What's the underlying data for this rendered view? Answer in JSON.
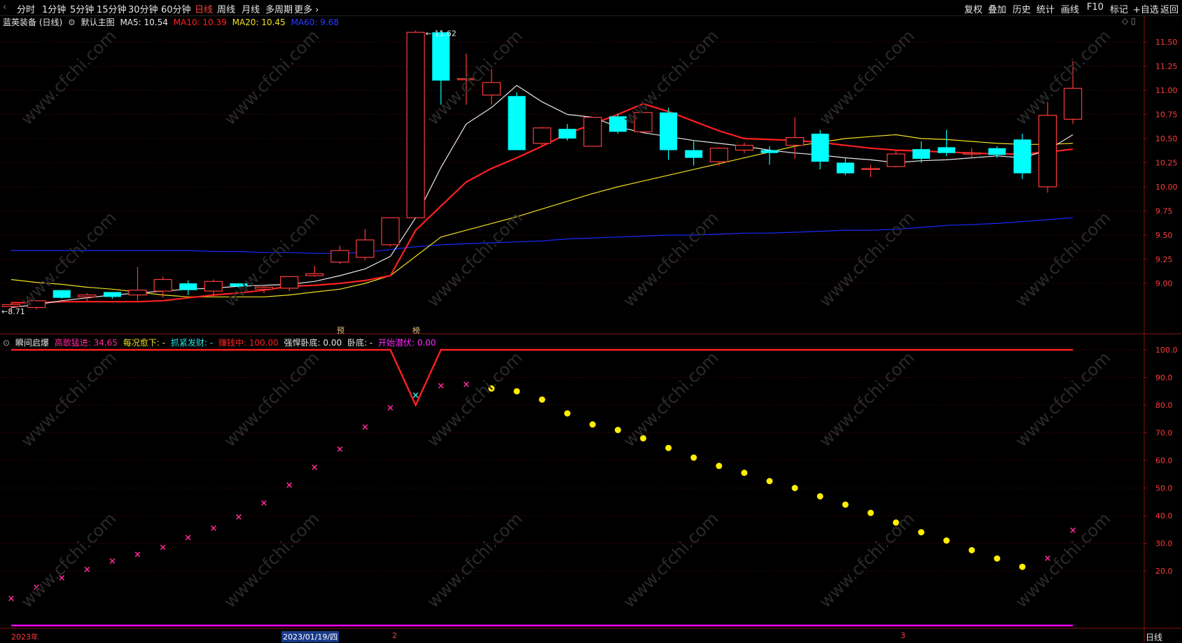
{
  "toolbar": {
    "periods": [
      "分时",
      "1分钟",
      "5分钟",
      "15分钟",
      "30分钟",
      "60分钟",
      "日线",
      "周线",
      "月线",
      "多周期",
      "更多 ›"
    ],
    "active_period": "日线",
    "right": [
      "复权",
      "叠加",
      "历史",
      "统计",
      "画线",
      "F10",
      "标记",
      "+自选",
      "返回"
    ]
  },
  "main": {
    "stock": "蓝英装备 (日线)",
    "template": "默认主图",
    "ma5": "MA5: 10.54",
    "ma10": "MA10: 10.39",
    "ma20": "MA20: 10.45",
    "ma60": "MA60: 9.68",
    "high_label": "11.62",
    "low_label": "8.71",
    "tags": [
      "预",
      "榜"
    ]
  },
  "sub": {
    "name": "瞬间启爆",
    "l1": "高歌猛进: 34.65",
    "l2": "每况愈下: -",
    "l3": "抓紧发财: -",
    "l4": "赚钱中: 100.00",
    "l5": "强悍卧底: 0.00",
    "l6": "卧底: -",
    "l7": "开始潜伏: 0.00"
  },
  "dates": {
    "left": "2023年",
    "cursor": "2023/01/19/四",
    "m2": "2",
    "m3": "3"
  },
  "period_label": "日线",
  "watermark": "www.cfchi.com",
  "colors": {
    "up": "#ff3b3b",
    "down": "#00ffff",
    "ma5": "#e8e8e8",
    "ma10": "#ff2020",
    "ma20": "#f0e020",
    "ma60": "#1a2aff",
    "pink": "#ff2a9a",
    "yellow": "#ffee00",
    "magenta": "#ff00ff"
  },
  "chart_data": [
    {
      "type": "candlestick",
      "ylim": [
        8.7,
        11.7
      ],
      "y_ticks": [
        9.0,
        9.25,
        9.5,
        9.75,
        10.0,
        10.25,
        10.5,
        10.75,
        11.0,
        11.25,
        11.5
      ],
      "candles": [
        {
          "o": 8.76,
          "h": 8.8,
          "l": 8.72,
          "c": 8.78
        },
        {
          "o": 8.75,
          "h": 8.82,
          "l": 8.73,
          "c": 8.82
        },
        {
          "o": 8.93,
          "h": 8.93,
          "l": 8.84,
          "c": 8.85
        },
        {
          "o": 8.86,
          "h": 8.9,
          "l": 8.82,
          "c": 8.88
        },
        {
          "o": 8.91,
          "h": 8.91,
          "l": 8.84,
          "c": 8.86
        },
        {
          "o": 8.88,
          "h": 9.17,
          "l": 8.82,
          "c": 8.93
        },
        {
          "o": 8.92,
          "h": 9.07,
          "l": 8.85,
          "c": 9.04
        },
        {
          "o": 9.0,
          "h": 9.03,
          "l": 8.88,
          "c": 8.93
        },
        {
          "o": 8.92,
          "h": 9.04,
          "l": 8.86,
          "c": 9.02
        },
        {
          "o": 9.0,
          "h": 9.0,
          "l": 8.95,
          "c": 8.97
        },
        {
          "o": 8.94,
          "h": 8.98,
          "l": 8.9,
          "c": 8.96
        },
        {
          "o": 8.95,
          "h": 9.07,
          "l": 8.92,
          "c": 9.07
        },
        {
          "o": 9.08,
          "h": 9.18,
          "l": 9.07,
          "c": 9.1
        },
        {
          "o": 9.22,
          "h": 9.39,
          "l": 9.2,
          "c": 9.34
        },
        {
          "o": 9.27,
          "h": 9.56,
          "l": 9.24,
          "c": 9.45
        },
        {
          "o": 9.4,
          "h": 9.67,
          "l": 9.38,
          "c": 9.68
        },
        {
          "o": 9.68,
          "h": 11.62,
          "l": 9.68,
          "c": 11.6
        },
        {
          "o": 11.6,
          "h": 11.62,
          "l": 10.85,
          "c": 11.1
        },
        {
          "o": 11.12,
          "h": 11.38,
          "l": 10.85,
          "c": 11.12
        },
        {
          "o": 10.95,
          "h": 11.22,
          "l": 10.85,
          "c": 11.08
        },
        {
          "o": 10.94,
          "h": 10.98,
          "l": 10.38,
          "c": 10.38
        },
        {
          "o": 10.45,
          "h": 10.62,
          "l": 10.43,
          "c": 10.61
        },
        {
          "o": 10.6,
          "h": 10.65,
          "l": 10.48,
          "c": 10.5
        },
        {
          "o": 10.42,
          "h": 10.72,
          "l": 10.42,
          "c": 10.72
        },
        {
          "o": 10.73,
          "h": 10.76,
          "l": 10.55,
          "c": 10.57
        },
        {
          "o": 10.57,
          "h": 10.77,
          "l": 10.56,
          "c": 10.77
        },
        {
          "o": 10.77,
          "h": 10.82,
          "l": 10.28,
          "c": 10.38
        },
        {
          "o": 10.38,
          "h": 10.48,
          "l": 10.22,
          "c": 10.3
        },
        {
          "o": 10.26,
          "h": 10.41,
          "l": 10.22,
          "c": 10.4
        },
        {
          "o": 10.38,
          "h": 10.46,
          "l": 10.35,
          "c": 10.43
        },
        {
          "o": 10.38,
          "h": 10.42,
          "l": 10.23,
          "c": 10.35
        },
        {
          "o": 10.43,
          "h": 10.72,
          "l": 10.29,
          "c": 10.51
        },
        {
          "o": 10.55,
          "h": 10.59,
          "l": 10.18,
          "c": 10.26
        },
        {
          "o": 10.25,
          "h": 10.3,
          "l": 10.12,
          "c": 10.14
        },
        {
          "o": 10.18,
          "h": 10.23,
          "l": 10.1,
          "c": 10.19
        },
        {
          "o": 10.21,
          "h": 10.37,
          "l": 10.2,
          "c": 10.34
        },
        {
          "o": 10.39,
          "h": 10.47,
          "l": 10.25,
          "c": 10.29
        },
        {
          "o": 10.41,
          "h": 10.59,
          "l": 10.32,
          "c": 10.35
        },
        {
          "o": 10.35,
          "h": 10.4,
          "l": 10.3,
          "c": 10.35
        },
        {
          "o": 10.4,
          "h": 10.42,
          "l": 10.3,
          "c": 10.33
        },
        {
          "o": 10.49,
          "h": 10.55,
          "l": 10.08,
          "c": 10.14
        },
        {
          "o": 10.0,
          "h": 10.88,
          "l": 9.94,
          "c": 10.74
        },
        {
          "o": 10.7,
          "h": 11.3,
          "l": 10.65,
          "c": 11.02
        }
      ],
      "ma5": [
        8.75,
        8.78,
        8.82,
        8.85,
        8.88,
        8.9,
        8.92,
        8.94,
        8.95,
        8.97,
        8.98,
        8.99,
        9.02,
        9.08,
        9.15,
        9.28,
        9.68,
        10.2,
        10.65,
        10.82,
        11.05,
        10.88,
        10.75,
        10.72,
        10.62,
        10.56,
        10.52,
        10.48,
        10.45,
        10.42,
        10.38,
        10.35,
        10.33,
        10.3,
        10.28,
        10.25,
        10.27,
        10.28,
        10.3,
        10.32,
        10.3,
        10.38,
        10.54
      ],
      "ma10": [
        8.8,
        8.8,
        8.81,
        8.81,
        8.81,
        8.81,
        8.82,
        8.85,
        8.88,
        8.9,
        8.93,
        8.97,
        8.98,
        9.0,
        9.03,
        9.08,
        9.55,
        9.8,
        10.05,
        10.19,
        10.3,
        10.42,
        10.55,
        10.65,
        10.75,
        10.86,
        10.78,
        10.68,
        10.58,
        10.5,
        10.49,
        10.48,
        10.46,
        10.43,
        10.4,
        10.38,
        10.37,
        10.36,
        10.35,
        10.34,
        10.34,
        10.36,
        10.39
      ],
      "ma20": [
        9.04,
        9.01,
        8.99,
        8.96,
        8.94,
        8.91,
        8.88,
        8.86,
        8.86,
        8.86,
        8.86,
        8.88,
        8.91,
        8.94,
        9.0,
        9.08,
        9.28,
        9.48,
        9.55,
        9.62,
        9.69,
        9.77,
        9.85,
        9.93,
        10.0,
        10.06,
        10.12,
        10.18,
        10.24,
        10.3,
        10.36,
        10.42,
        10.46,
        10.5,
        10.52,
        10.54,
        10.5,
        10.49,
        10.47,
        10.45,
        10.44,
        10.44,
        10.45
      ],
      "ma60": [
        9.34,
        9.34,
        9.34,
        9.34,
        9.34,
        9.34,
        9.34,
        9.34,
        9.33,
        9.33,
        9.32,
        9.32,
        9.31,
        9.31,
        9.32,
        9.35,
        9.38,
        9.4,
        9.41,
        9.42,
        9.43,
        9.44,
        9.46,
        9.47,
        9.48,
        9.49,
        9.5,
        9.5,
        9.51,
        9.52,
        9.52,
        9.53,
        9.54,
        9.55,
        9.55,
        9.56,
        9.58,
        9.6,
        9.61,
        9.62,
        9.64,
        9.66,
        9.68
      ]
    },
    {
      "type": "scatter",
      "ylim": [
        0,
        105
      ],
      "y_ticks": [
        20,
        30,
        40,
        50,
        60,
        70,
        80,
        90,
        100
      ],
      "values": [
        10,
        14,
        17.5,
        20.5,
        23.5,
        26,
        28.5,
        32,
        35.5,
        39.5,
        44.5,
        51,
        57.5,
        64,
        72,
        79,
        83.5,
        87,
        87.5,
        86,
        85,
        82,
        77,
        73,
        71,
        68,
        64.5,
        61,
        58,
        55.5,
        52.5,
        50,
        47,
        44,
        41,
        37.5,
        34,
        31,
        27.5,
        24.5,
        21.5,
        24.5,
        34.65
      ],
      "kinds": [
        "x",
        "x",
        "x",
        "x",
        "x",
        "x",
        "x",
        "x",
        "x",
        "x",
        "x",
        "x",
        "x",
        "x",
        "x",
        "x",
        "xc",
        "x",
        "x",
        "o",
        "o",
        "o",
        "o",
        "o",
        "o",
        "o",
        "o",
        "o",
        "o",
        "o",
        "o",
        "o",
        "o",
        "o",
        "o",
        "o",
        "o",
        "o",
        "o",
        "o",
        "o",
        "x",
        "x"
      ],
      "top_line": 100,
      "bottom_line": 2,
      "v_dip": [
        100,
        80,
        100
      ]
    }
  ]
}
